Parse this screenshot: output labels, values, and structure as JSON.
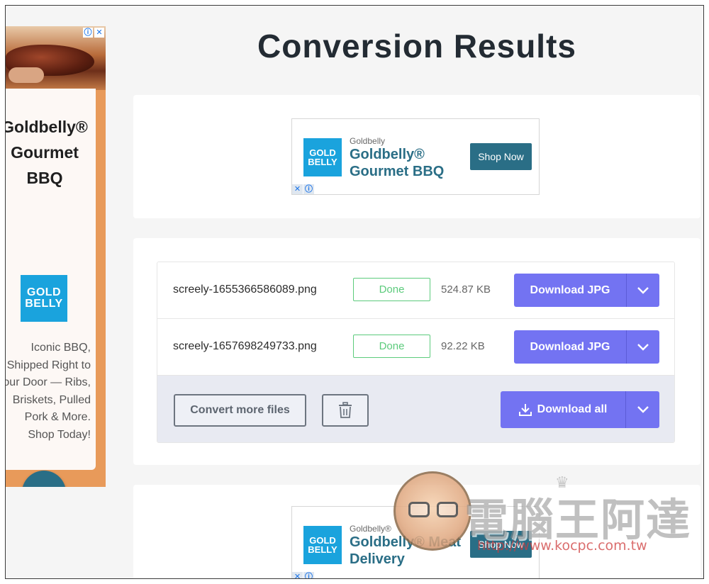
{
  "page": {
    "title": "Conversion Results"
  },
  "side_ad": {
    "title_lines": [
      "Goldbelly®",
      "Gourmet",
      "BBQ"
    ],
    "logo_lines": [
      "GOLD",
      "BELLY"
    ],
    "description_lines": [
      "Iconic BBQ,",
      "Shipped Right to",
      "Your Door — Ribs,",
      "Briskets, Pulled",
      "Pork & More.",
      "Shop Today!"
    ],
    "arrow": "›",
    "info_icon": "ⓘ",
    "close_icon": "✕"
  },
  "top_banner": {
    "logo_lines": [
      "GOLD",
      "BELLY"
    ],
    "brand": "Goldbelly",
    "headline": "Goldbelly® Gourmet BBQ",
    "cta": "Shop Now",
    "close_icon": "✕",
    "info_icon": "ⓘ"
  },
  "files": [
    {
      "name": "screely-1655366586089.png",
      "status": "Done",
      "size": "524.87 KB",
      "download_label": "Download JPG"
    },
    {
      "name": "screely-1657698249733.png",
      "status": "Done",
      "size": "92.22 KB",
      "download_label": "Download JPG"
    }
  ],
  "actions": {
    "convert_more": "Convert more files",
    "download_all": "Download all"
  },
  "bottom_banner": {
    "logo_lines": [
      "GOLD",
      "BELLY"
    ],
    "brand": "Goldbelly®",
    "headline": "Goldbelly® Meat Delivery",
    "cta": "Shop Now",
    "close_icon": "✕",
    "info_icon": "ⓘ"
  },
  "watermark": {
    "chinese": "電腦王阿達",
    "url": "http://www.kocpc.com.tw"
  },
  "colors": {
    "primary": "#7373f2",
    "success": "#5ccb7c",
    "ad_teal": "#2a6e86",
    "ad_blue": "#1aa3dd",
    "ad_orange": "#e89a5a"
  }
}
